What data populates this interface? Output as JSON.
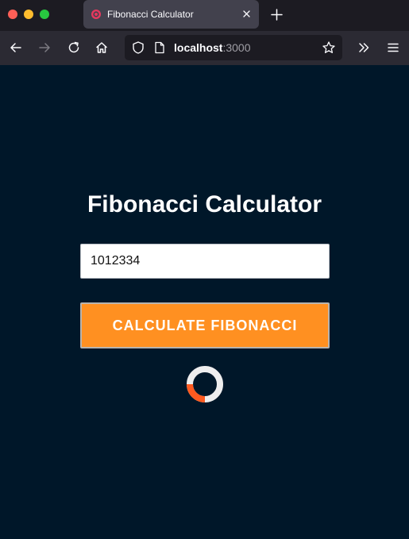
{
  "browser": {
    "tab": {
      "title": "Fibonacci Calculator",
      "favicon": "ring-favicon-icon"
    },
    "url": {
      "host": "localhost",
      "port": ":3000"
    },
    "icons": {
      "back": "arrow-left-icon",
      "forward": "arrow-right-icon",
      "reload": "reload-icon",
      "home": "home-icon",
      "shield": "shield-icon",
      "page": "page-icon",
      "bookmark": "star-icon",
      "overflow": "double-chevron-icon",
      "menu": "hamburger-menu-icon",
      "new_tab": "plus-icon",
      "close_tab": "close-icon"
    }
  },
  "page": {
    "title": "Fibonacci Calculator",
    "input": {
      "value": "1012334"
    },
    "button_label": "CALCULATE FIBONACCI",
    "spinner": {
      "ring_color": "#eeeeee",
      "arc_color": "#ff5a1f"
    }
  },
  "colors": {
    "background": "#001729",
    "accent": "#ff9021"
  }
}
